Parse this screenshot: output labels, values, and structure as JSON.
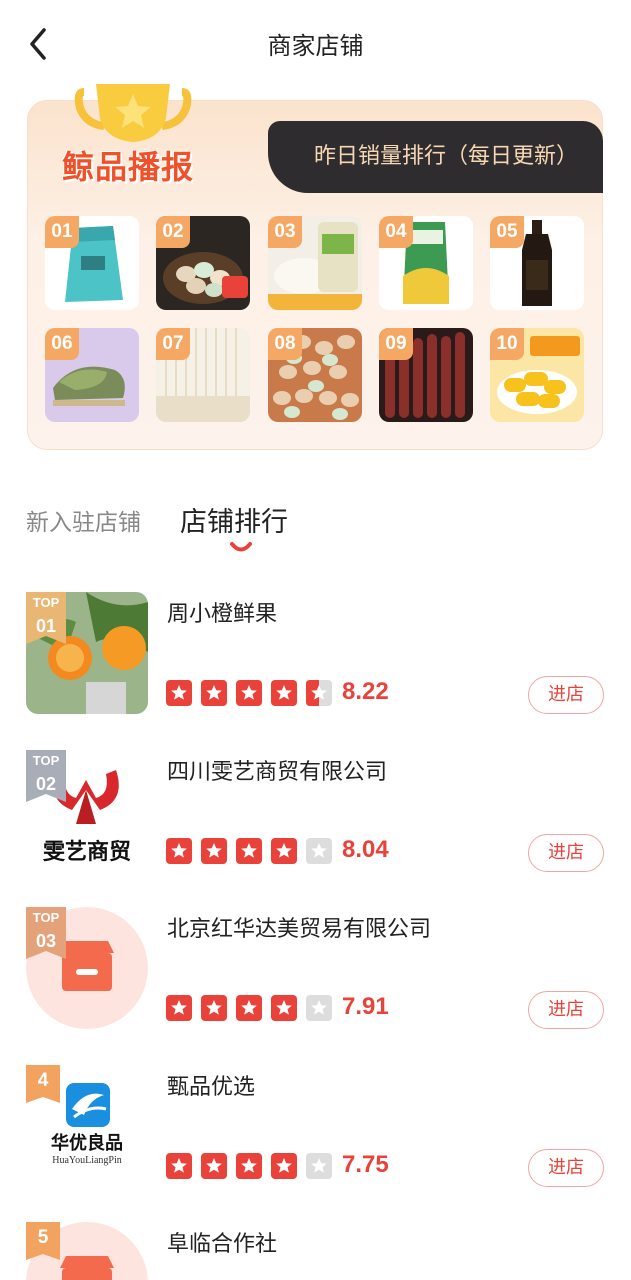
{
  "header": {
    "title": "商家店铺"
  },
  "ranking_card": {
    "brand_title": "鲸品播报",
    "banner_text": "昨日销量排行（每日更新）",
    "products": [
      {
        "rank": "01"
      },
      {
        "rank": "02"
      },
      {
        "rank": "03"
      },
      {
        "rank": "04"
      },
      {
        "rank": "05"
      },
      {
        "rank": "06"
      },
      {
        "rank": "07"
      },
      {
        "rank": "08"
      },
      {
        "rank": "09"
      },
      {
        "rank": "10"
      }
    ]
  },
  "tabs": [
    {
      "label": "新入驻店铺",
      "active": false
    },
    {
      "label": "店铺排行",
      "active": true
    }
  ],
  "stores": [
    {
      "top_label": "TOP",
      "rank": "01",
      "name": "周小橙鲜果",
      "score": "8.22",
      "rating": 4.5,
      "button": "进店"
    },
    {
      "top_label": "TOP",
      "rank": "02",
      "name": "四川雯艺商贸有限公司",
      "score": "8.04",
      "rating": 4,
      "button": "进店",
      "logo_text": "雯艺商贸"
    },
    {
      "top_label": "TOP",
      "rank": "03",
      "name": "北京红华达美贸易有限公司",
      "score": "7.91",
      "rating": 4,
      "button": "进店"
    },
    {
      "top_label": "",
      "rank": "4",
      "name": "甄品优选",
      "score": "7.75",
      "rating": 4,
      "button": "进店",
      "logo_text": "华优良品",
      "logo_subtext": "HuaYouLiangPin"
    },
    {
      "top_label": "",
      "rank": "5",
      "name": "阜临合作社",
      "score": "",
      "rating": 0,
      "button": ""
    }
  ],
  "colors": {
    "accent": "#e8423a",
    "star_active": "#e8423a",
    "star_inactive": "#dddddd",
    "badge_gold": "#e9b673",
    "badge_silver": "#a9adb8",
    "badge_bronze": "#e4a27a",
    "badge_plain": "#f2a360"
  }
}
